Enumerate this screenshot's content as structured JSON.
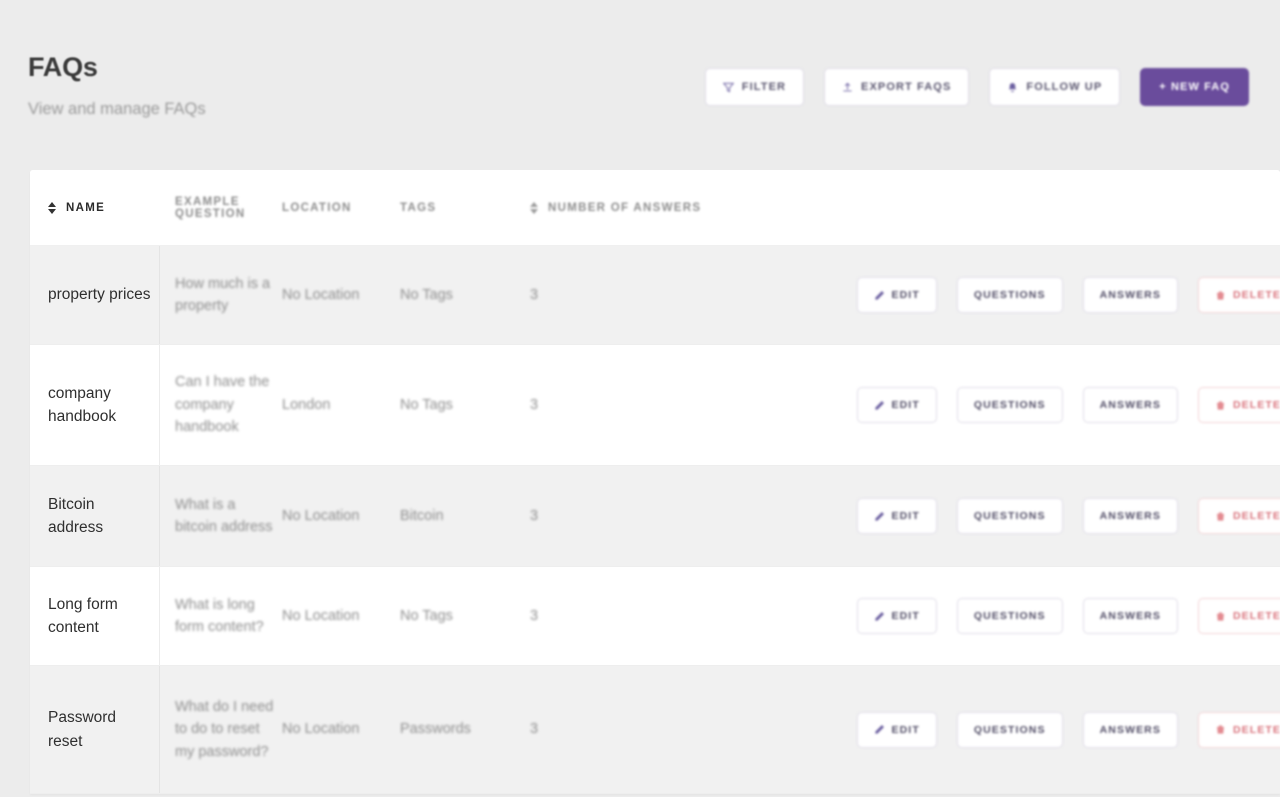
{
  "header": {
    "title": "FAQs",
    "subtitle": "View and manage FAQs"
  },
  "toolbar": {
    "filter_label": "FILTER",
    "export_label": "EXPORT FAQS",
    "follow_up_label": "FOLLOW UP",
    "new_faq_label": "+ NEW FAQ",
    "primary_color": "#6a4c9c"
  },
  "table": {
    "columns": [
      {
        "key": "name",
        "label": "NAME",
        "sortable": true
      },
      {
        "key": "example_question",
        "label": "EXAMPLE QUESTION",
        "sortable": false
      },
      {
        "key": "location",
        "label": "LOCATION",
        "sortable": false
      },
      {
        "key": "tags",
        "label": "TAGS",
        "sortable": false
      },
      {
        "key": "number_of_answers",
        "label": "NUMBER OF ANSWERS",
        "sortable": true
      }
    ],
    "row_actions": {
      "edit_label": "EDIT",
      "questions_label": "QUESTIONS",
      "answers_label": "ANSWERS",
      "delete_label": "DELETE",
      "delete_color": "#d9737c"
    },
    "rows": [
      {
        "name": "property prices",
        "example_question": "How much is a property",
        "location": "No Location",
        "tags": "No Tags",
        "number_of_answers": "3"
      },
      {
        "name": "company handbook",
        "example_question": "Can I have the company handbook",
        "location": "London",
        "tags": "No Tags",
        "number_of_answers": "3"
      },
      {
        "name": "Bitcoin address",
        "example_question": "What is a bitcoin address",
        "location": "No Location",
        "tags": "Bitcoin",
        "number_of_answers": "3"
      },
      {
        "name": "Long form content",
        "example_question": "What is long form content?",
        "location": "No Location",
        "tags": "No Tags",
        "number_of_answers": "3"
      },
      {
        "name": "Password reset",
        "example_question": "What do I need to do to reset my password?",
        "location": "No Location",
        "tags": "Passwords",
        "number_of_answers": "3"
      }
    ]
  }
}
